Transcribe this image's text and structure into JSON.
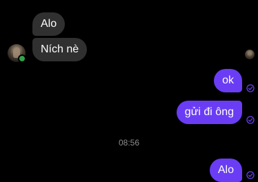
{
  "conversation": {
    "incoming": [
      {
        "text": "Alo"
      },
      {
        "text": "Ních nè"
      }
    ],
    "outgoing": [
      {
        "text": "ok"
      },
      {
        "text": "gửi đi ông"
      },
      {
        "text": "Alo"
      }
    ],
    "timestamp": "08:56"
  },
  "status": {
    "contact_online": true,
    "online_color": "#31a24c",
    "read_receipt_icon": "check-circle-icon",
    "seen_indicator": "contact-avatar"
  },
  "colors": {
    "background": "#000000",
    "incoming_bubble": "#303030",
    "outgoing_bubble": "#6a3df5",
    "timestamp_text": "#8e8e8e",
    "receipt_icon": "#6a3df5"
  }
}
